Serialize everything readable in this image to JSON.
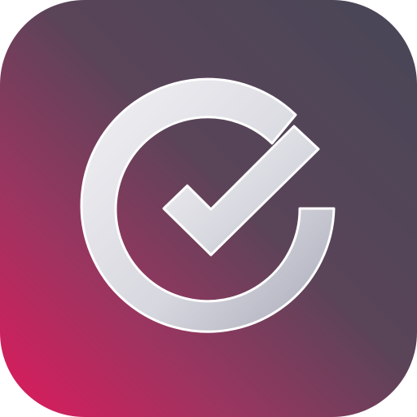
{
  "icon": {
    "name": "check-circle-app-icon",
    "glyph": "check-circle-icon"
  },
  "colors": {
    "background_dark": "#474757",
    "background_mid": "#5a4458",
    "background_accent": "#e0195c",
    "glyph_light": "#f2f2f5",
    "glyph_mid": "#c9c9d3",
    "glyph_shadow": "#a9a9b8",
    "glyph_outline": "#ffffff"
  }
}
